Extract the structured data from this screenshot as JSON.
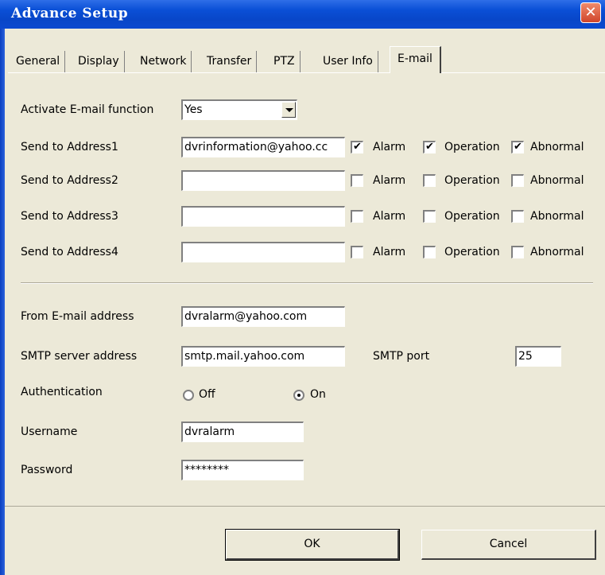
{
  "window": {
    "title": "Advance Setup",
    "close_glyph": "✕"
  },
  "tabs": [
    {
      "label": "General"
    },
    {
      "label": "Display"
    },
    {
      "label": "Network"
    },
    {
      "label": "Transfer"
    },
    {
      "label": "PTZ"
    },
    {
      "label": "User Info"
    },
    {
      "label": "E-mail"
    }
  ],
  "active_tab": "E-mail",
  "email": {
    "activate": {
      "label": "Activate E-mail function",
      "value": "Yes"
    },
    "send_to": [
      {
        "label": "Send to Address1",
        "value": "dvrinformation@yahoo.cc",
        "alarm": "✔",
        "operation": "✔",
        "abnormal": "✔"
      },
      {
        "label": "Send to Address2",
        "value": "",
        "alarm": "",
        "operation": "",
        "abnormal": ""
      },
      {
        "label": "Send to Address3",
        "value": "",
        "alarm": "",
        "operation": "",
        "abnormal": ""
      },
      {
        "label": "Send to Address4",
        "value": "",
        "alarm": "",
        "operation": "",
        "abnormal": ""
      }
    ],
    "check_labels": {
      "alarm": "Alarm",
      "operation": "Operation",
      "abnormal": "Abnormal"
    },
    "from": {
      "label": "From E-mail address",
      "value": "dvralarm@yahoo.com"
    },
    "smtp_server": {
      "label": "SMTP server address",
      "value": "smtp.mail.yahoo.com"
    },
    "smtp_port": {
      "label": "SMTP port",
      "value": "25"
    },
    "authentication": {
      "label": "Authentication",
      "off_label": "Off",
      "on_label": "On",
      "selected": "On"
    },
    "username": {
      "label": "Username",
      "value": "dvralarm"
    },
    "password": {
      "label": "Password",
      "value": "********"
    }
  },
  "buttons": {
    "ok": "OK",
    "cancel": "Cancel"
  }
}
